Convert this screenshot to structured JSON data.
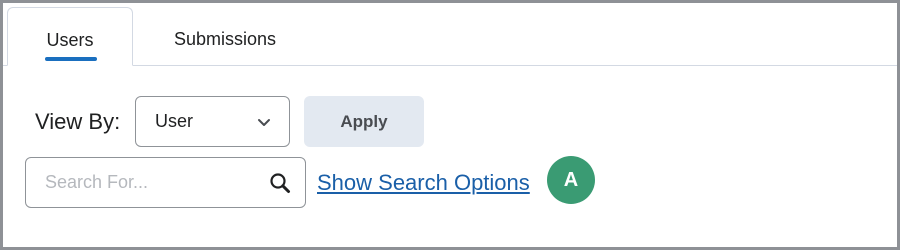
{
  "tabs": [
    {
      "label": "Users",
      "active": true
    },
    {
      "label": "Submissions",
      "active": false
    }
  ],
  "view_by": {
    "label": "View By:",
    "selected": "User"
  },
  "apply_label": "Apply",
  "search": {
    "placeholder": "Search For...",
    "value": ""
  },
  "search_options_link": "Show Search Options",
  "callout": "A",
  "colors": {
    "accent": "#1a6fbf",
    "link": "#1a5fa8",
    "button_bg": "#e3e9f1",
    "callout_bg": "#3a9b73"
  },
  "icons": [
    "chevron-down-icon",
    "search-icon"
  ]
}
